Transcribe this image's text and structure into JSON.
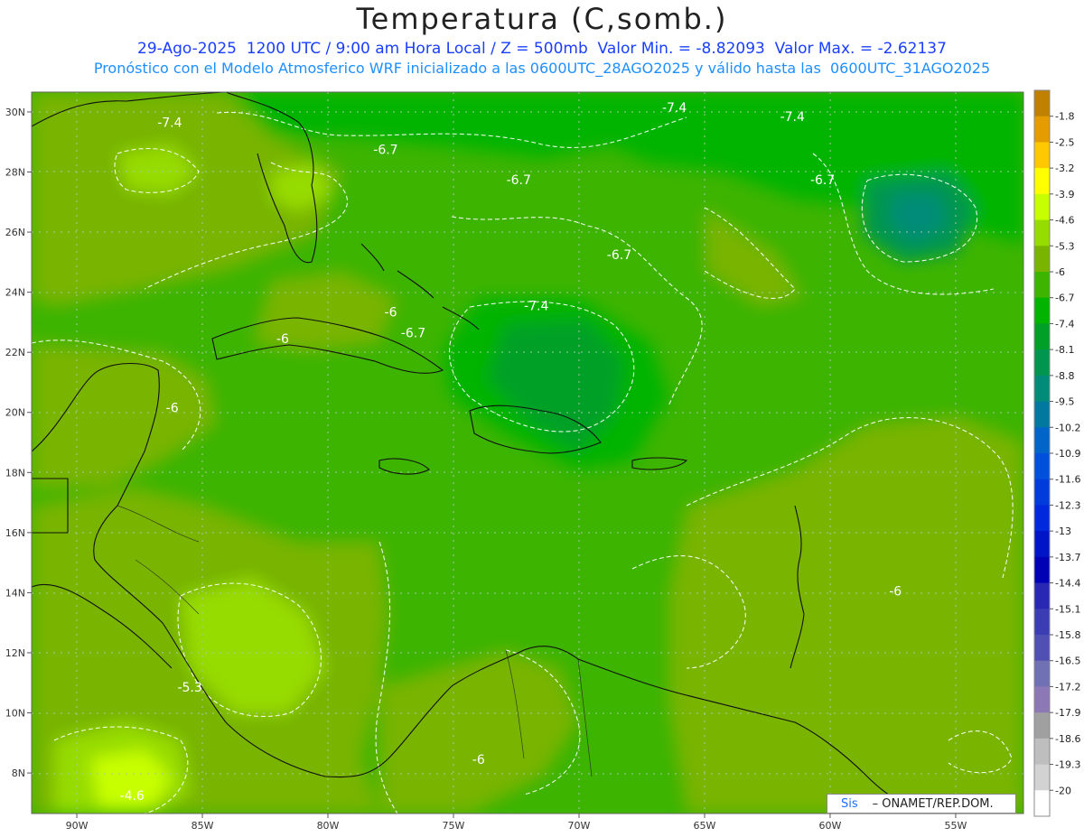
{
  "header": {
    "title": "Temperatura (C,somb.)",
    "subtitle_line1": "29-Ago-2025  1200 UTC / 9:00 am Hora Local / Z = 500mb  Valor Min. = -8.82093  Valor Max. = -2.62137",
    "subtitle_line2": "Pronóstico con el Modelo Atmosferico WRF inicializado a las 0600UTC_28AGO2025 y válido hasta las  0600UTC_31AGO2025"
  },
  "map": {
    "lon_labels": [
      "90W",
      "85W",
      "80W",
      "75W",
      "70W",
      "65W",
      "60W",
      "55W"
    ],
    "lat_labels": [
      "30N",
      "28N",
      "26N",
      "24N",
      "22N",
      "20N",
      "18N",
      "16N",
      "14N",
      "12N",
      "10N",
      "8N"
    ],
    "contour_labels": [
      {
        "text": "-7.4",
        "lon": -86.3,
        "lat": 29.5
      },
      {
        "text": "-7.4",
        "lon": -66.2,
        "lat": 30.0
      },
      {
        "text": "-7.4",
        "lon": -61.5,
        "lat": 29.7
      },
      {
        "text": "-6.7",
        "lon": -77.7,
        "lat": 28.6
      },
      {
        "text": "-6.7",
        "lon": -72.4,
        "lat": 27.6
      },
      {
        "text": "-6.7",
        "lon": -60.3,
        "lat": 27.6
      },
      {
        "text": "-6.7",
        "lon": -68.4,
        "lat": 25.1
      },
      {
        "text": "-7.4",
        "lon": -71.7,
        "lat": 23.4
      },
      {
        "text": "-6",
        "lon": -77.5,
        "lat": 23.2
      },
      {
        "text": "-6",
        "lon": -81.8,
        "lat": 22.3
      },
      {
        "text": "-6.7",
        "lon": -76.6,
        "lat": 22.5
      },
      {
        "text": "-6",
        "lon": -86.2,
        "lat": 20.0
      },
      {
        "text": "-6",
        "lon": -57.4,
        "lat": 13.9
      },
      {
        "text": "-5.3",
        "lon": -85.5,
        "lat": 10.7
      },
      {
        "text": "-6",
        "lon": -74.0,
        "lat": 8.3
      },
      {
        "text": "-4.6",
        "lon": -87.8,
        "lat": 7.1
      }
    ]
  },
  "colorbar": {
    "levels": [
      "-1.8",
      "-2.5",
      "-3.2",
      "-3.9",
      "-4.6",
      "-5.3",
      "-6",
      "-6.7",
      "-7.4",
      "-8.1",
      "-8.8",
      "-9.5",
      "-10.2",
      "-10.9",
      "-11.6",
      "-12.3",
      "-13",
      "-13.7",
      "-14.4",
      "-15.1",
      "-15.8",
      "-16.5",
      "-17.2",
      "-17.9",
      "-18.6",
      "-19.3",
      "-20"
    ],
    "colors": [
      "#c08000",
      "#e59c00",
      "#ffc800",
      "#ffff00",
      "#c8ff00",
      "#96dc00",
      "#78b400",
      "#3cb400",
      "#00b400",
      "#00a028",
      "#009650",
      "#008c78",
      "#0078a0",
      "#0064c8",
      "#0050dc",
      "#003cdc",
      "#0028dc",
      "#0014c8",
      "#0000b4",
      "#2828b4",
      "#3c3cb4",
      "#5050b4",
      "#7070b4",
      "#8c78b4",
      "#a0a0a0",
      "#bebebe",
      "#d2d2d2",
      "#ffffff"
    ]
  },
  "footer": {
    "sis_label": "Sis",
    "credit": "– ONAMET/REP.DOM."
  }
}
